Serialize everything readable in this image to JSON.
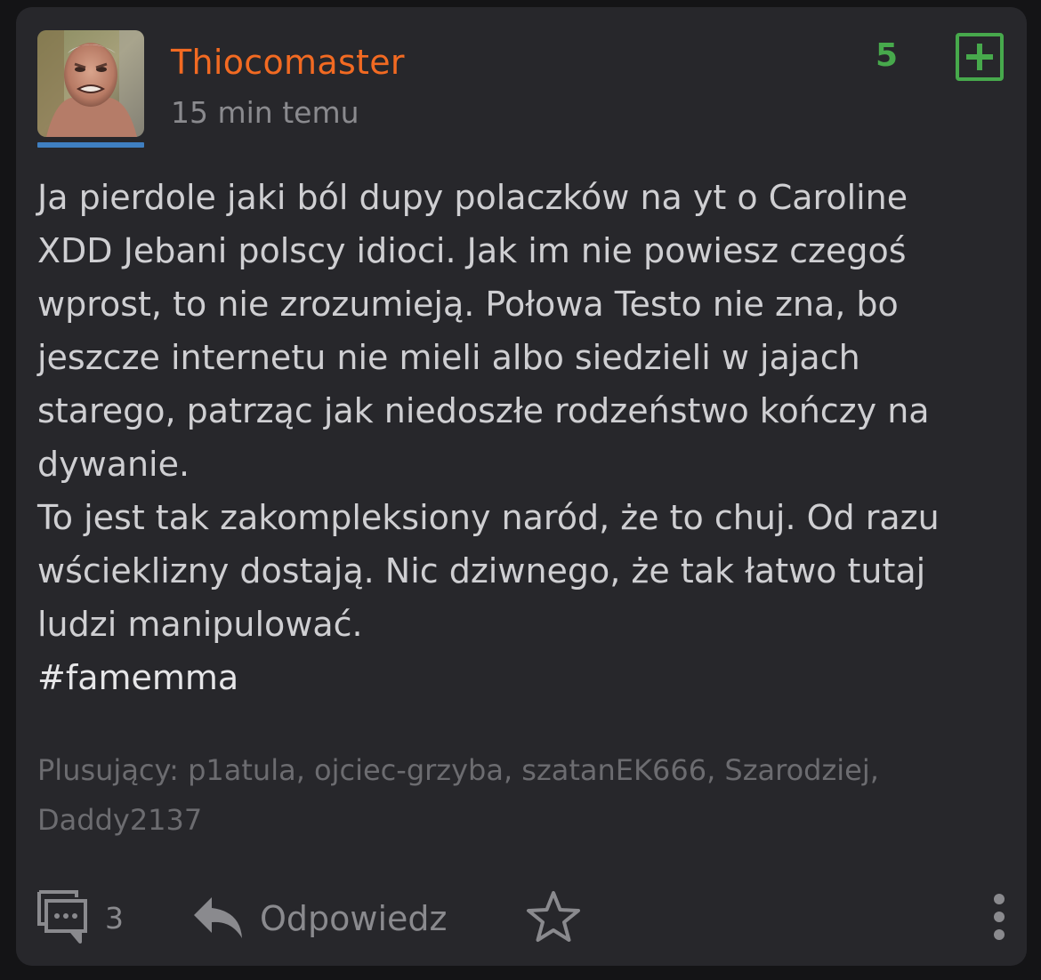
{
  "post": {
    "author": "Thiocomaster",
    "time": "15 min temu",
    "votes": "5",
    "body": "Ja pierdole jaki ból dupy polaczków na yt o Caroline\nXDD Jebani polscy idioci. Jak im nie powiesz czegoś\nwprost, to nie zrozumieją. Połowa Testo nie zna, bo\njeszcze internetu nie mieli albo siedzieli w jajach\nstarego, patrząc jak niedoszłe rodzeństwo kończy na\ndywanie.\nTo jest tak zakompleksiony naród, że to chuj. Od razu\nwścieklizny dostają. Nic dziwnego, że tak łatwo tutaj\nludzi manipulować.",
    "tag": "#famemma",
    "upvoters": "Plusujący: p1atula, ojciec-grzyba, szatanEK666, Szarodziej, Daddy2137"
  },
  "actions": {
    "comments_count": "3",
    "reply_label": "Odpowiedz"
  },
  "icons": {
    "plus": "plus-square-icon",
    "comments": "comments-icon",
    "reply": "reply-arrow-icon",
    "favorite": "star-outline-icon",
    "more": "vertical-dots-icon"
  },
  "colors": {
    "username": "#f26a22",
    "vote": "#47a94c",
    "avatar_bar": "#3f7fc1",
    "card_bg": "#27272b",
    "page_bg": "#141416"
  }
}
